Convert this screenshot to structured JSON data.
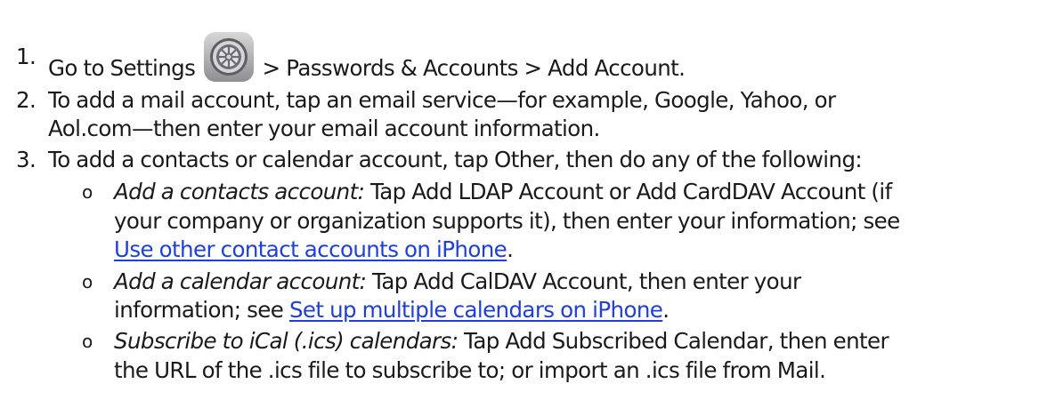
{
  "steps": [
    {
      "number": "1.",
      "text_before_icon": "Go to Settings",
      "icon": "settings-gear-icon",
      "text_after_icon": "> Passwords & Accounts > Add Account."
    },
    {
      "number": "2.",
      "line1": "To add a mail account, tap an email service—for example, Google, Yahoo, or",
      "line2": "Aol.com—then enter your email account information."
    },
    {
      "number": "3.",
      "line1": "To add a contacts or calendar account, tap Other, then do any of the following:",
      "subitems": [
        {
          "bullet": "o",
          "label": "Add a contacts account:",
          "line1_rest": " Tap Add LDAP Account or Add CardDAV Account (if",
          "line2": "your company or organization supports it), then enter your information; see",
          "link": "Use other contact accounts on iPhone",
          "link_suffix": "."
        },
        {
          "bullet": "o",
          "label": "Add a calendar account:",
          "line1_rest": " Tap Add CalDAV Account, then enter your",
          "line2_prefix": "information; see ",
          "link": "Set up multiple calendars on iPhone",
          "link_suffix": "."
        },
        {
          "bullet": "o",
          "label": "Subscribe to iCal (.ics) calendars:",
          "line1_rest": " Tap Add Subscribed Calendar, then enter",
          "line2": "the URL of the .ics file to subscribe to; or import an .ics file from Mail."
        }
      ]
    }
  ]
}
